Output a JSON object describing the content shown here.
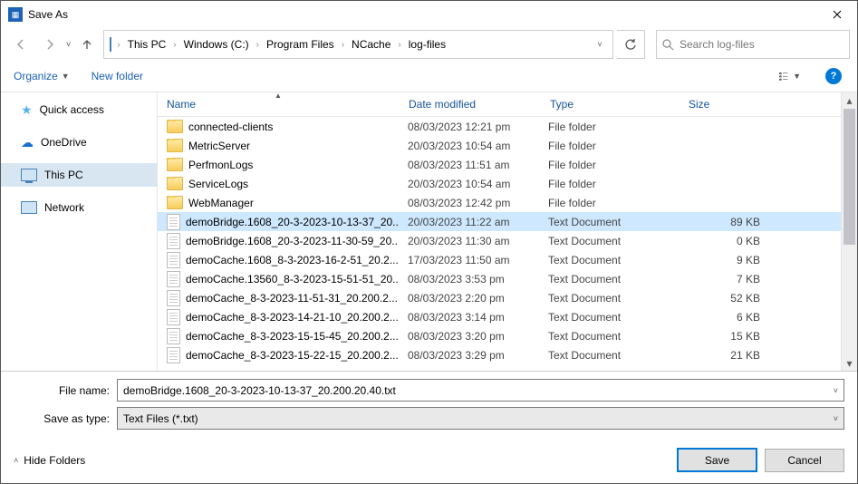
{
  "window": {
    "title": "Save As"
  },
  "breadcrumb": [
    "This PC",
    "Windows (C:)",
    "Program Files",
    "NCache",
    "log-files"
  ],
  "search": {
    "placeholder": "Search log-files"
  },
  "toolbar": {
    "organize": "Organize",
    "new_folder": "New folder"
  },
  "sidebar": {
    "items": [
      {
        "label": "Quick access",
        "icon": "star"
      },
      {
        "label": "OneDrive",
        "icon": "cloud"
      },
      {
        "label": "This PC",
        "icon": "monitor",
        "selected": true
      },
      {
        "label": "Network",
        "icon": "network"
      }
    ]
  },
  "columns": {
    "name": "Name",
    "date": "Date modified",
    "type": "Type",
    "size": "Size"
  },
  "rows": [
    {
      "name": "connected-clients",
      "date": "08/03/2023 12:21 pm",
      "type": "File folder",
      "size": "",
      "kind": "folder"
    },
    {
      "name": "MetricServer",
      "date": "20/03/2023 10:54 am",
      "type": "File folder",
      "size": "",
      "kind": "folder"
    },
    {
      "name": "PerfmonLogs",
      "date": "08/03/2023 11:51 am",
      "type": "File folder",
      "size": "",
      "kind": "folder"
    },
    {
      "name": "ServiceLogs",
      "date": "20/03/2023 10:54 am",
      "type": "File folder",
      "size": "",
      "kind": "folder"
    },
    {
      "name": "WebManager",
      "date": "08/03/2023 12:42 pm",
      "type": "File folder",
      "size": "",
      "kind": "folder"
    },
    {
      "name": "demoBridge.1608_20-3-2023-10-13-37_20...",
      "date": "20/03/2023 11:22 am",
      "type": "Text Document",
      "size": "89 KB",
      "kind": "file",
      "selected": true
    },
    {
      "name": "demoBridge.1608_20-3-2023-11-30-59_20...",
      "date": "20/03/2023 11:30 am",
      "type": "Text Document",
      "size": "0 KB",
      "kind": "file"
    },
    {
      "name": "demoCache.1608_8-3-2023-16-2-51_20.2...",
      "date": "17/03/2023 11:50 am",
      "type": "Text Document",
      "size": "9 KB",
      "kind": "file"
    },
    {
      "name": "demoCache.13560_8-3-2023-15-51-51_20...",
      "date": "08/03/2023 3:53 pm",
      "type": "Text Document",
      "size": "7 KB",
      "kind": "file"
    },
    {
      "name": "demoCache_8-3-2023-11-51-31_20.200.2...",
      "date": "08/03/2023 2:20 pm",
      "type": "Text Document",
      "size": "52 KB",
      "kind": "file"
    },
    {
      "name": "demoCache_8-3-2023-14-21-10_20.200.2...",
      "date": "08/03/2023 3:14 pm",
      "type": "Text Document",
      "size": "6 KB",
      "kind": "file"
    },
    {
      "name": "demoCache_8-3-2023-15-15-45_20.200.2...",
      "date": "08/03/2023 3:20 pm",
      "type": "Text Document",
      "size": "15 KB",
      "kind": "file"
    },
    {
      "name": "demoCache_8-3-2023-15-22-15_20.200.2...",
      "date": "08/03/2023 3:29 pm",
      "type": "Text Document",
      "size": "21 KB",
      "kind": "file"
    }
  ],
  "form": {
    "file_name_label": "File name:",
    "file_name_value": "demoBridge.1608_20-3-2023-10-13-37_20.200.20.40.txt",
    "save_type_label": "Save as type:",
    "save_type_value": "Text Files (*.txt)"
  },
  "footer": {
    "hide_folders": "Hide Folders",
    "save": "Save",
    "cancel": "Cancel"
  }
}
